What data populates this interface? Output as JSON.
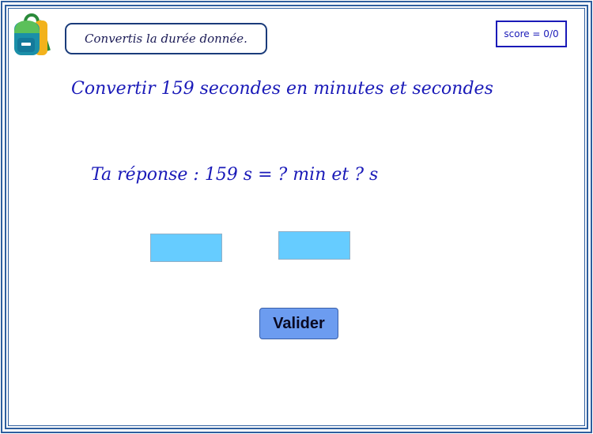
{
  "header": {
    "instruction": "Convertis la durée donnée.",
    "score": "score = 0/0",
    "icon": "backpack-icon"
  },
  "exercise": {
    "question": "Convertir 159 secondes en minutes et secondes",
    "answer_prompt": "Ta réponse : 159 s = ? min et ? s"
  },
  "inputs": {
    "minutes": {
      "value": "",
      "placeholder": ""
    },
    "seconds": {
      "value": "",
      "placeholder": ""
    }
  },
  "actions": {
    "validate_label": "Valider"
  },
  "colors": {
    "frame": "#2e5e9e",
    "text": "#1a1ab8",
    "input_fill": "#66ccff",
    "button_fill": "#6c9cf0"
  }
}
